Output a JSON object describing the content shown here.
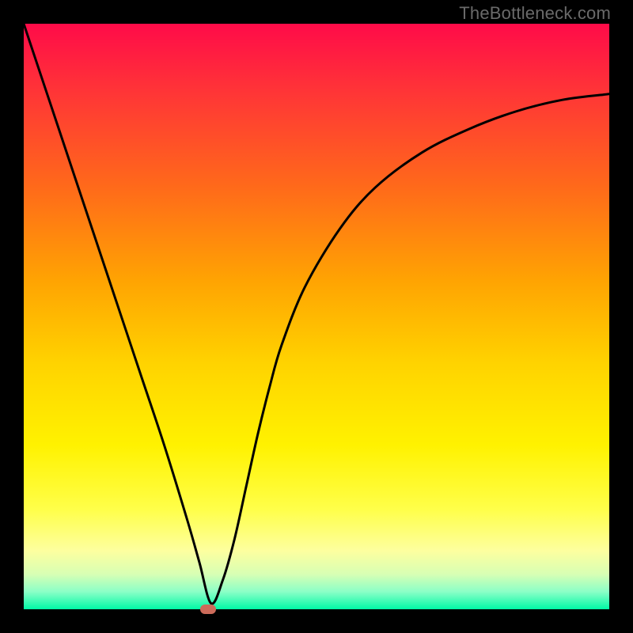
{
  "watermark": "TheBottleneck.com",
  "chart_data": {
    "type": "line",
    "title": "",
    "xlabel": "",
    "ylabel": "",
    "xlim": [
      0,
      100
    ],
    "ylim": [
      0,
      100
    ],
    "grid": false,
    "legend": false,
    "series": [
      {
        "name": "curve",
        "x": [
          0,
          4,
          8,
          12,
          16,
          20,
          24,
          28,
          30,
          32,
          34,
          36,
          38,
          40,
          42,
          44,
          48,
          54,
          60,
          68,
          76,
          84,
          92,
          100
        ],
        "values": [
          100,
          88,
          76,
          64,
          52,
          40,
          28,
          15,
          8,
          1,
          5,
          12,
          21,
          30,
          38,
          45,
          55,
          65,
          72,
          78,
          82,
          85,
          87,
          88
        ]
      }
    ],
    "marker": {
      "x": 31.5,
      "y": 0
    },
    "colors": {
      "curve_stroke": "#000000",
      "marker_fill": "#cc6b5a",
      "frame": "#000000"
    }
  }
}
